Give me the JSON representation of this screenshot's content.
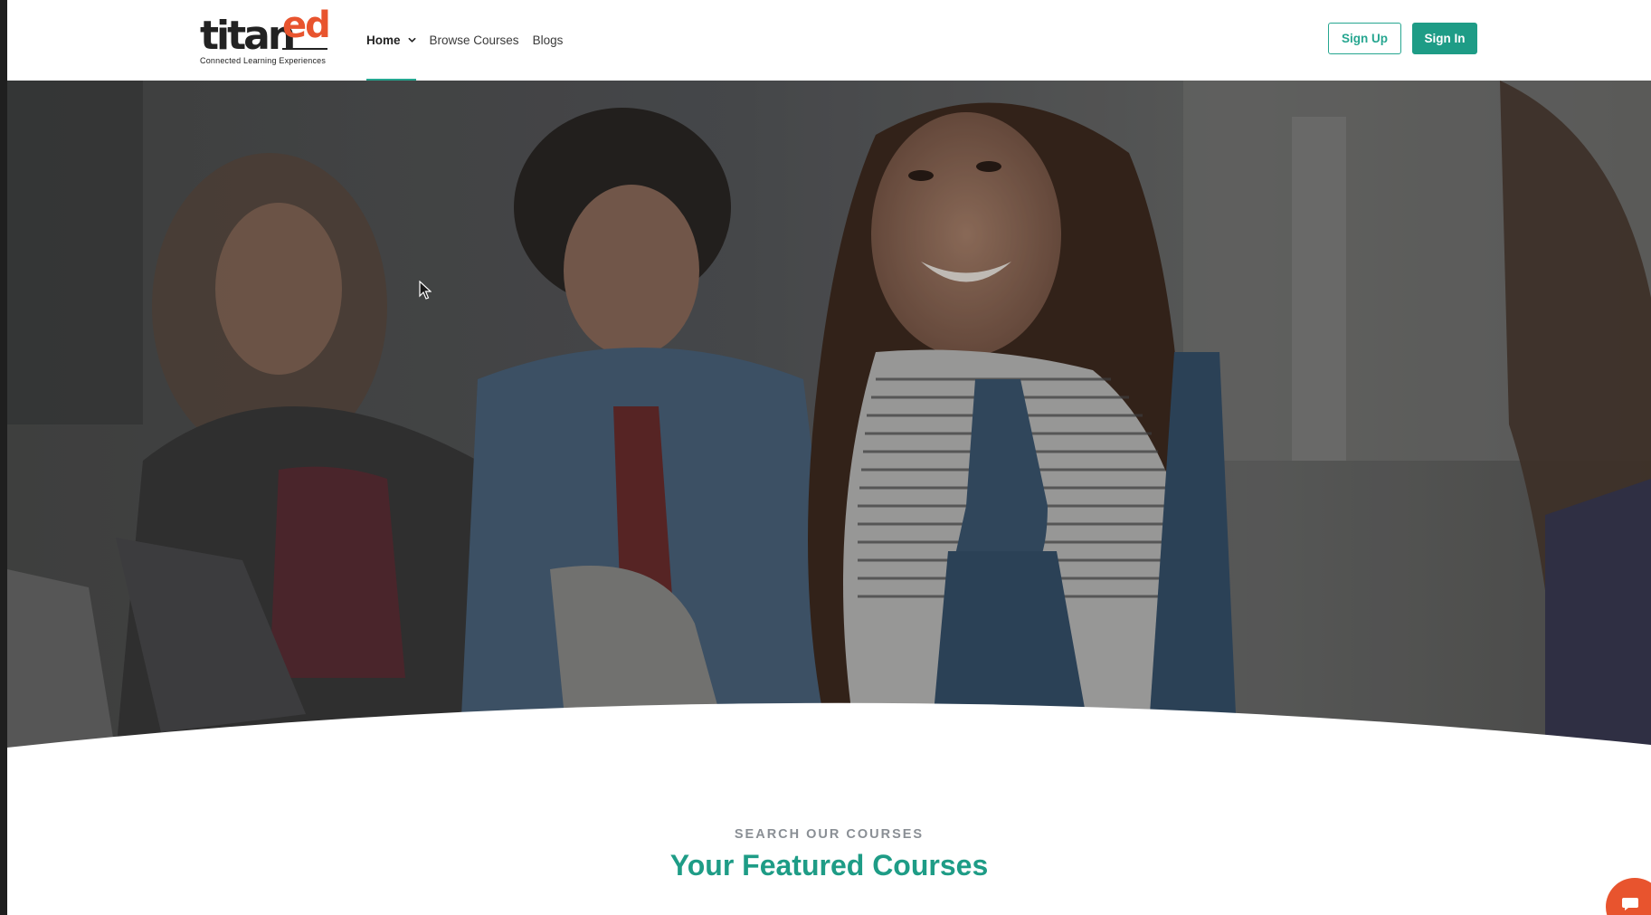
{
  "brand": {
    "logo_main": "titan",
    "logo_accent": "ed",
    "tagline": "Connected Learning Experiences",
    "accent_color": "#e8542e",
    "primary_color": "#1e9c86"
  },
  "nav": {
    "items": [
      {
        "label": "Home",
        "active": true,
        "has_dropdown": true
      },
      {
        "label": "Browse Courses",
        "active": false
      },
      {
        "label": "Blogs",
        "active": false
      }
    ]
  },
  "auth": {
    "signup_label": "Sign Up",
    "signin_label": "Sign In"
  },
  "hero": {
    "image": "students-in-classroom-photo"
  },
  "featured": {
    "kicker": "SEARCH OUR COURSES",
    "title": "Your Featured Courses"
  },
  "chat": {
    "icon": "chat-icon"
  }
}
